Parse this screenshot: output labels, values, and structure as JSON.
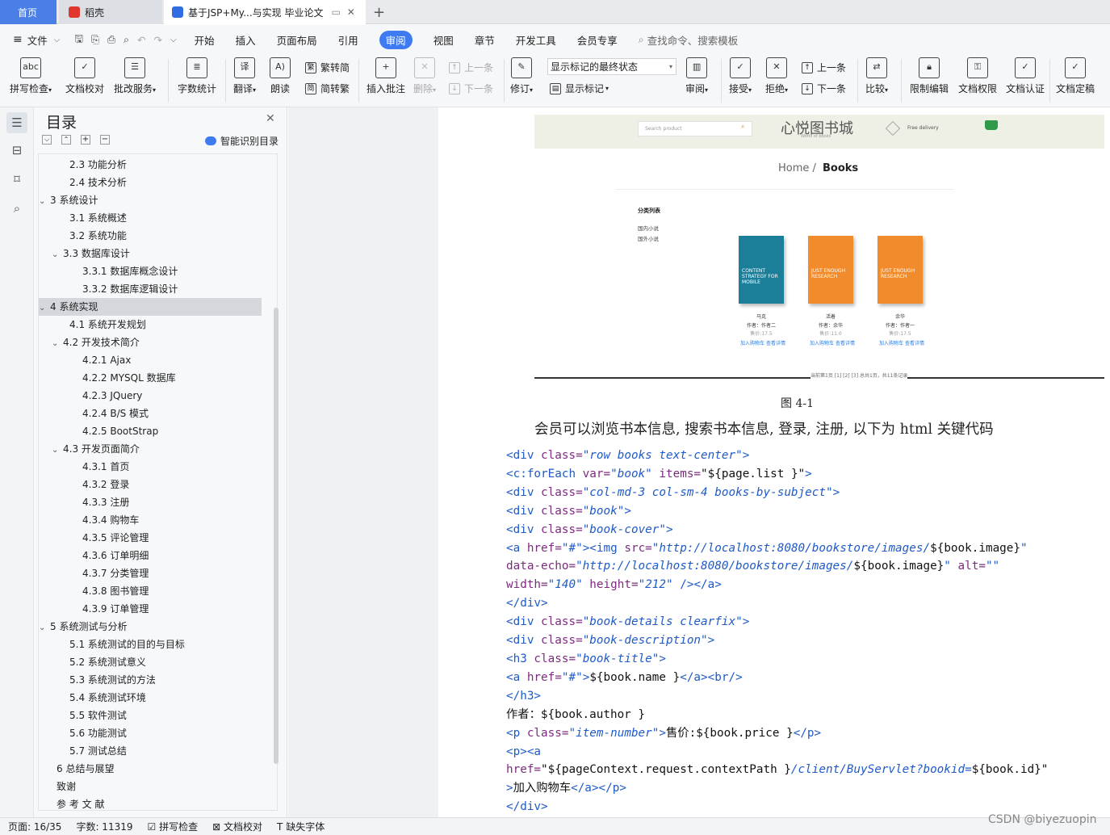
{
  "tabs": {
    "home": "首页",
    "daoke": "稻壳",
    "doc": "基于JSP+My...与实现 毕业论文"
  },
  "menu": {
    "file": "文件",
    "items": [
      "开始",
      "插入",
      "页面布局",
      "引用",
      "审阅",
      "视图",
      "章节",
      "开发工具",
      "会员专享"
    ],
    "search": "查找命令、搜索模板"
  },
  "ribbon": {
    "spell": "拼写检查",
    "proof": "文档校对",
    "batch": "批改服务",
    "count": "字数统计",
    "translate": "翻译",
    "read": "朗读",
    "trad": "繁转简",
    "simp": "简转繁",
    "insert_comment": "插入批注",
    "delete": "删除",
    "prev_comment": "上一条",
    "next_comment": "下一条",
    "revise": "修订",
    "markup_state": "显示标记的最终状态",
    "show_markup": "显示标记",
    "review": "审阅",
    "accept": "接受",
    "reject": "拒绝",
    "prev": "上一条",
    "next": "下一条",
    "compare": "比较",
    "restrict": "限制编辑",
    "perm": "文档权限",
    "cert": "文档认证",
    "final": "文档定稿"
  },
  "nav": {
    "title": "目录",
    "smart": "智能识别目录"
  },
  "toc": [
    {
      "t": "2.3  功能分析",
      "l": 2
    },
    {
      "t": "2.4  技术分析",
      "l": 2
    },
    {
      "t": "3  系统设计",
      "l": 1,
      "c": "v"
    },
    {
      "t": "3.1  系统概述",
      "l": 2
    },
    {
      "t": "3.2  系统功能",
      "l": 2
    },
    {
      "t": "3.3  数据库设计",
      "l": 2,
      "c": "v"
    },
    {
      "t": "3.3.1  数据库概念设计",
      "l": 3
    },
    {
      "t": "3.3.2  数据库逻辑设计",
      "l": 3
    },
    {
      "t": "4  系统实现",
      "l": 1,
      "c": "v",
      "sel": true
    },
    {
      "t": "4.1  系统开发规划",
      "l": 2
    },
    {
      "t": "4.2  开发技术简介",
      "l": 2,
      "c": "v"
    },
    {
      "t": "4.2.1 Ajax",
      "l": 3
    },
    {
      "t": "4.2.2 MYSQL 数据库",
      "l": 3
    },
    {
      "t": "4.2.3 JQuery",
      "l": 3
    },
    {
      "t": "4.2.4 B/S 模式",
      "l": 3
    },
    {
      "t": "4.2.5 BootStrap",
      "l": 3
    },
    {
      "t": "4.3  开发页面简介",
      "l": 2,
      "c": "v"
    },
    {
      "t": "4.3.1 首页",
      "l": 3
    },
    {
      "t": "4.3.2 登录",
      "l": 3
    },
    {
      "t": "4.3.3 注册",
      "l": 3
    },
    {
      "t": "4.3.4 购物车",
      "l": 3
    },
    {
      "t": "4.3.5 评论管理",
      "l": 3
    },
    {
      "t": "4.3.6 订单明细",
      "l": 3
    },
    {
      "t": "4.3.7 分类管理",
      "l": 3
    },
    {
      "t": "4.3.8 图书管理",
      "l": 3
    },
    {
      "t": "4.3.9 订单管理",
      "l": 3
    },
    {
      "t": "5  系统测试与分析",
      "l": 1,
      "c": "v"
    },
    {
      "t": "5.1  系统测试的目的与目标",
      "l": 2
    },
    {
      "t": "5.2  系统测试意义",
      "l": 2
    },
    {
      "t": "5.3  系统测试的方法",
      "l": 2
    },
    {
      "t": "5.4  系统测试环境",
      "l": 2
    },
    {
      "t": "5.5  软件测试",
      "l": 2
    },
    {
      "t": "5.6  功能测试",
      "l": 2
    },
    {
      "t": "5.7  测试总结",
      "l": 2
    },
    {
      "t": "6  总结与展望",
      "l": 1
    },
    {
      "t": "致谢",
      "l": 1
    },
    {
      "t": "参 考 文 献",
      "l": 1
    }
  ],
  "shot": {
    "search": "Search product",
    "store": "心悦图书城",
    "sub": "World of books",
    "delivery": "Free delivery",
    "home": "Home /",
    "books": "Books",
    "cat": "分类列表",
    "cat1": "国内小说",
    "cat2": "国外小说",
    "book_items": [
      {
        "title": "CONTENT STRATEGY FOR MOBILE",
        "name": "马克",
        "author": "作者：作者二",
        "price": "售价:17.5",
        "color": "#1b7f9a"
      },
      {
        "title": "JUST ENOUGH RESEARCH",
        "name": "活着",
        "author": "作者：余华",
        "price": "售价:11.0",
        "color": "#f28b2c"
      },
      {
        "title": "JUST ENOUGH RESEARCH",
        "name": "余华",
        "author": "作者：作者一",
        "price": "售价:17.5",
        "color": "#f28b2c"
      }
    ],
    "links": "加入购物车  查看详情",
    "footer": "当前第1页  [1] [2] [3]  总共1页，共11条记录"
  },
  "caption": "图 4-1",
  "para": "会员可以浏览书本信息, 搜索书本信息, 登录, 注册, 以下为 html 关键代码",
  "code": [
    [
      [
        "tg",
        "<div"
      ],
      [
        "an",
        " class="
      ],
      [
        "av",
        "\"row books text-center\""
      ],
      [
        "tg",
        ">"
      ]
    ],
    [
      [
        "tg",
        "<c:forEach"
      ],
      [
        "an",
        " var="
      ],
      [
        "av",
        "\"book\""
      ],
      [
        "an",
        " items="
      ],
      [
        "tx",
        "\"${page.list }\""
      ],
      [
        "tg",
        ">"
      ]
    ],
    [
      [
        "tg",
        "<div"
      ],
      [
        "an",
        " class="
      ],
      [
        "av",
        "\"col-md-3 col-sm-4 books-by-subject\""
      ],
      [
        "tg",
        ">"
      ]
    ],
    [
      [
        "tg",
        "<div"
      ],
      [
        "an",
        " class="
      ],
      [
        "av",
        "\"book\""
      ],
      [
        "tg",
        ">"
      ]
    ],
    [
      [
        "tg",
        "<div"
      ],
      [
        "an",
        " class="
      ],
      [
        "av",
        "\"book-cover\""
      ],
      [
        "tg",
        ">"
      ]
    ],
    [
      [
        "tg",
        "<a"
      ],
      [
        "an",
        " href="
      ],
      [
        "av",
        "\"#\""
      ],
      [
        "tg",
        "><img"
      ],
      [
        "an",
        " src="
      ],
      [
        "av",
        "\"http://localhost:8080/bookstore/images/"
      ],
      [
        "tx",
        "${book.image}"
      ],
      [
        "av",
        "\""
      ]
    ],
    [
      [
        "an",
        "data-echo="
      ],
      [
        "av",
        "\"http://localhost:8080/bookstore/images/"
      ],
      [
        "tx",
        "${book.image}"
      ],
      [
        "av",
        "\""
      ],
      [
        "an",
        " alt="
      ],
      [
        "av",
        "\"\""
      ]
    ],
    [
      [
        "an",
        "width="
      ],
      [
        "av",
        "\"140\""
      ],
      [
        "an",
        " height="
      ],
      [
        "av",
        "\"212\""
      ],
      [
        "tg",
        " /></a>"
      ]
    ],
    [
      [
        "tg",
        "</div>"
      ]
    ],
    [
      [
        "tg",
        "<div"
      ],
      [
        "an",
        " class="
      ],
      [
        "av",
        "\"book-details clearfix\""
      ],
      [
        "tg",
        ">"
      ]
    ],
    [
      [
        "tg",
        "<div"
      ],
      [
        "an",
        " class="
      ],
      [
        "av",
        "\"book-description\""
      ],
      [
        "tg",
        ">"
      ]
    ],
    [
      [
        "tg",
        "<h3"
      ],
      [
        "an",
        " class="
      ],
      [
        "av",
        "\"book-title\""
      ],
      [
        "tg",
        ">"
      ]
    ],
    [
      [
        "tg",
        "<a"
      ],
      [
        "an",
        " href="
      ],
      [
        "av",
        "\"#\""
      ],
      [
        "tg",
        ">"
      ],
      [
        "tx",
        "${book.name }"
      ],
      [
        "tg",
        "</a><br/>"
      ]
    ],
    [
      [
        "tg",
        "</h3>"
      ]
    ],
    [
      [
        "tx",
        "作者：${book.author }"
      ]
    ],
    [
      [
        "tg",
        "<p"
      ],
      [
        "an",
        " class="
      ],
      [
        "av",
        "\"item-number\""
      ],
      [
        "tg",
        ">"
      ],
      [
        "tx",
        "售价:${book.price }"
      ],
      [
        "tg",
        "</p>"
      ]
    ],
    [
      [
        "tg",
        "<p><a"
      ]
    ],
    [
      [
        "an",
        "href="
      ],
      [
        "tx",
        "\"${pageContext.request.contextPath }"
      ],
      [
        "av",
        "/client/BuyServlet?bookid="
      ],
      [
        "tx",
        "${book.id}\""
      ]
    ],
    [
      [
        "tg",
        ">"
      ],
      [
        "tx",
        "加入购物车"
      ],
      [
        "tg",
        "</a></p>"
      ]
    ],
    [
      [
        "tg",
        "</div>"
      ]
    ]
  ],
  "status": {
    "page": "页面: 16/35",
    "words": "字数: 11319",
    "spell": "拼写检查",
    "proof": "文档校对",
    "font": "缺失字体"
  },
  "watermark": "CSDN @biyezuopin"
}
